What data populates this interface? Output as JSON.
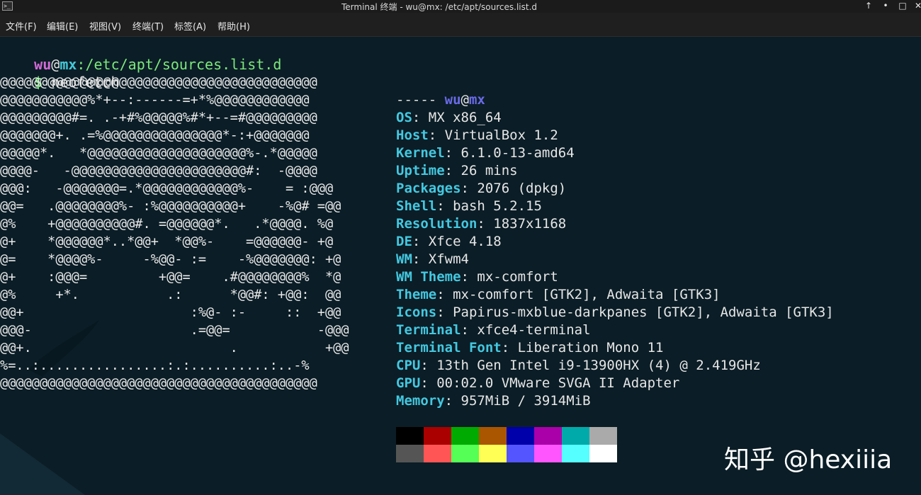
{
  "window": {
    "title": "Terminal 终端 - wu@mx: /etc/apt/sources.list.d",
    "app_icon": ">_",
    "buttons": {
      "up": "↑",
      "minimize": "•",
      "maximize": "□",
      "close": "✕"
    }
  },
  "menubar": [
    {
      "label": "文件(F)"
    },
    {
      "label": "编辑(E)"
    },
    {
      "label": "视图(V)"
    },
    {
      "label": "终端(T)"
    },
    {
      "label": "标签(A)"
    },
    {
      "label": "帮助(H)"
    }
  ],
  "prompt_line": {
    "user": "wu",
    "at": "@",
    "host": "mx",
    "path": ":/etc/apt/sources.list.d"
  },
  "command_line": {
    "prompt": "$",
    "command": " neofetch"
  },
  "ascii_art": [
    "@@@@@@@@@@@@@@@@@@@@@@@@@@@@@@@@@@@@@@@@",
    "@@@@@@@@@@@%*+--:------=+*%@@@@@@@@@@@@",
    "@@@@@@@@@#=. .-+#%@@@@@%#*+--=#@@@@@@@@@",
    "@@@@@@@+. .=%@@@@@@@@@@@@@@@*-:+@@@@@@@",
    "@@@@@*.   *@@@@@@@@@@@@@@@@@@@@%-.*@@@@@",
    "@@@@-   -@@@@@@@@@@@@@@@@@@@@@@#:  -@@@@",
    "@@@:   -@@@@@@@=.*@@@@@@@@@@@@%-    = :@@@",
    "@@=   .@@@@@@@@%- :%@@@@@@@@@@+    -%@# =@@",
    "@%    +@@@@@@@@@@#. =@@@@@@*.   .*@@@@. %@",
    "@+    *@@@@@@*..*@@+  *@@%-    =@@@@@@- +@",
    "@=    *@@@@%-     -%@@- :=    -%@@@@@@@: +@",
    "@+    :@@@=         +@@=    .#@@@@@@@@%  *@",
    "@%     +*.           .:      *@@#: +@@:  @@",
    "@@+                     :%@- :-     ::  +@@",
    "@@@-                    .=@@=           -@@@",
    "@@+.                         .           +@@",
    "%=..:................:.:..........:..-%",
    "@@@@@@@@@@@@@@@@@@@@@@@@@@@@@@@@@@@@@@@@"
  ],
  "neofetch": {
    "user": "wu",
    "at": "@",
    "host": "mx",
    "separator": "-----",
    "fields": [
      {
        "key": "OS",
        "value": ": MX x86_64"
      },
      {
        "key": "Host",
        "value": ": VirtualBox 1.2"
      },
      {
        "key": "Kernel",
        "value": ": 6.1.0-13-amd64"
      },
      {
        "key": "Uptime",
        "value": ": 26 mins"
      },
      {
        "key": "Packages",
        "value": ": 2076 (dpkg)"
      },
      {
        "key": "Shell",
        "value": ": bash 5.2.15"
      },
      {
        "key": "Resolution",
        "value": ": 1837x1168"
      },
      {
        "key": "DE",
        "value": ": Xfce 4.18"
      },
      {
        "key": "WM",
        "value": ": Xfwm4"
      },
      {
        "key": "WM Theme",
        "value": ": mx-comfort"
      },
      {
        "key": "Theme",
        "value": ": mx-comfort [GTK2], Adwaita [GTK3]"
      },
      {
        "key": "Icons",
        "value": ": Papirus-mxblue-darkpanes [GTK2], Adwaita [GTK3]"
      },
      {
        "key": "Terminal",
        "value": ": xfce4-terminal"
      },
      {
        "key": "Terminal Font",
        "value": ": Liberation Mono 11"
      },
      {
        "key": "CPU",
        "value": ": 13th Gen Intel i9-13900HX (4) @ 2.419GHz"
      },
      {
        "key": "GPU",
        "value": ": 00:02.0 VMware SVGA II Adapter"
      },
      {
        "key": "Memory",
        "value": ": 957MiB / 3914MiB"
      }
    ]
  },
  "palette": {
    "normal": [
      "#000000",
      "#aa0000",
      "#00aa00",
      "#aa5500",
      "#0000aa",
      "#aa00aa",
      "#00aaaa",
      "#aaaaaa"
    ],
    "bright": [
      "#555555",
      "#ff5555",
      "#55ff55",
      "#ffff55",
      "#5555ff",
      "#ff55ff",
      "#55ffff",
      "#ffffff"
    ]
  },
  "watermark": "知乎 @hexiiia"
}
